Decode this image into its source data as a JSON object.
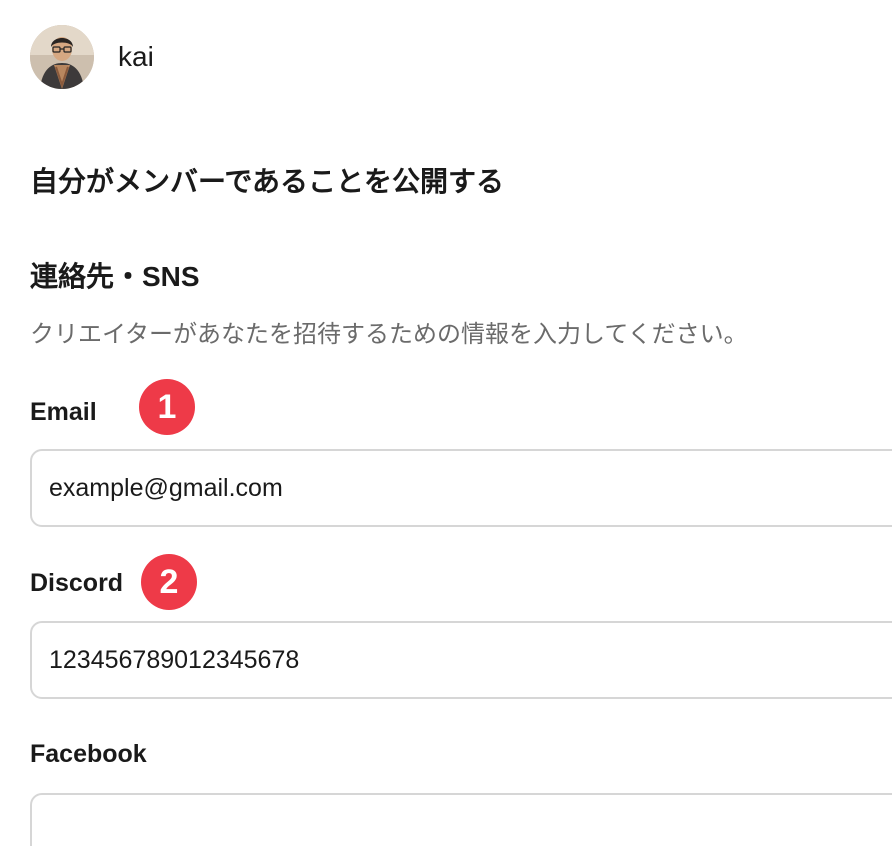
{
  "user": {
    "name": "kai"
  },
  "sections": {
    "public_membership": "自分がメンバーであることを公開する",
    "contact_title": "連絡先・SNS",
    "contact_helper": "クリエイターがあなたを招待するための情報を入力してください。"
  },
  "fields": {
    "email": {
      "label": "Email",
      "value": "example@gmail.com",
      "badge": "1"
    },
    "discord": {
      "label": "Discord",
      "value": "123456789012345678",
      "badge": "2"
    },
    "facebook": {
      "label": "Facebook",
      "value": ""
    }
  },
  "colors": {
    "badge": "#ee3a48",
    "input_border": "#d6d6d6",
    "helper_text": "#6b6b6b"
  }
}
